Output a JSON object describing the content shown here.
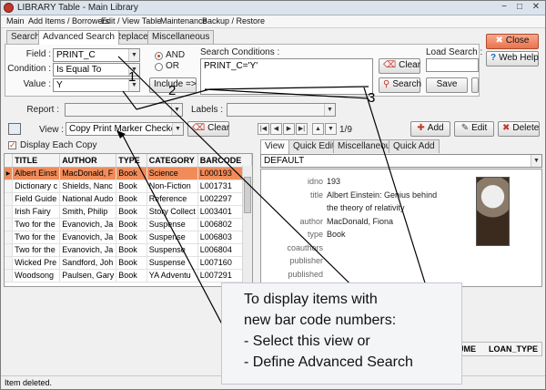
{
  "window": {
    "title": "LIBRARY Table - Main Library",
    "minimize": "−",
    "maximize": "□",
    "close": "✕"
  },
  "menu": [
    "Main",
    "Add Items / Borrowers",
    "Edit / View Table",
    "Maintenance",
    "Backup / Restore"
  ],
  "tabs": [
    "Search",
    "Advanced Search",
    "Replace",
    "Miscellaneous"
  ],
  "advanced_search": {
    "field_label": "Field :",
    "field_value": "PRINT_C",
    "condition_label": "Condition :",
    "condition_value": "Is Equal To",
    "value_label": "Value :",
    "value_value": "Y",
    "and_label": "AND",
    "or_label": "OR",
    "include_button": "Include =>",
    "search_conditions_label": "Search Conditions :",
    "search_conditions_text": "PRINT_C='Y'",
    "clear_button": "Clear",
    "search_button": "Search",
    "load_search_label": "Load Search :",
    "save_button": "Save"
  },
  "right_buttons": {
    "close": "Close",
    "web_help": "Web Help"
  },
  "report_label": "Report :",
  "labels_label": "Labels :",
  "view_bar": {
    "view_label": "View :",
    "view_value": "Copy Print Marker Checked",
    "clear_button": "Clear",
    "record_counter": "1/9",
    "add_button": "Add",
    "edit_button": "Edit",
    "delete_button": "Delete"
  },
  "display_each_copy": "Display Each Copy",
  "grid": {
    "columns": [
      "TITLE",
      "AUTHOR",
      "TYPE",
      "CATEGORY",
      "BARCODE"
    ],
    "rows": [
      [
        "Albert Einst",
        "MacDonald, F",
        "Book",
        "Science",
        "L000193"
      ],
      [
        "Dictionary c",
        "Shields, Nanc",
        "Book",
        "Non-Fiction",
        "L001731"
      ],
      [
        "Field Guide",
        "National Audo",
        "Book",
        "Reference",
        "L002297"
      ],
      [
        "Irish Fairy",
        "Smith, Philip",
        "Book",
        "Story Collect",
        "L003401"
      ],
      [
        "Two for the",
        "Evanovich, Ja",
        "Book",
        "Suspense",
        "L006802"
      ],
      [
        "Two for the",
        "Evanovich, Ja",
        "Book",
        "Suspense",
        "L006803"
      ],
      [
        "Two for the",
        "Evanovich, Ja",
        "Book",
        "Suspense",
        "L006804"
      ],
      [
        "Wicked Pre",
        "Sandford, Joh",
        "Book",
        "Suspense",
        "L007160"
      ],
      [
        "Woodsong",
        "Paulsen, Gary",
        "Book",
        "YA Adventu",
        "L007291"
      ]
    ]
  },
  "detail_tabs": [
    "View",
    "Quick Edit",
    "Miscellaneous",
    "Quick Add"
  ],
  "detail_view_select": "DEFAULT",
  "detail": {
    "fields": [
      {
        "key": "idno",
        "value": "193"
      },
      {
        "key": "title",
        "value": "Albert Einstein: Genius behind"
      },
      {
        "key": "",
        "value": "the theory of relativity"
      },
      {
        "key": "author",
        "value": "MacDonald, Fiona"
      },
      {
        "key": "type",
        "value": "Book"
      },
      {
        "key": "coauthors",
        "value": ""
      },
      {
        "key": "publisher",
        "value": ""
      },
      {
        "key": "published",
        "value": ""
      },
      {
        "key": "place",
        "value": ""
      }
    ]
  },
  "bottom_grid_columns": [
    "UME",
    "LOAN_TYPE"
  ],
  "callout": {
    "lines": [
      "To display items with",
      "new bar code numbers:",
      "- Select this view  or",
      "- Define Advanced Search"
    ]
  },
  "markers": [
    "1",
    "2",
    "3"
  ],
  "status_text": "Item deleted."
}
